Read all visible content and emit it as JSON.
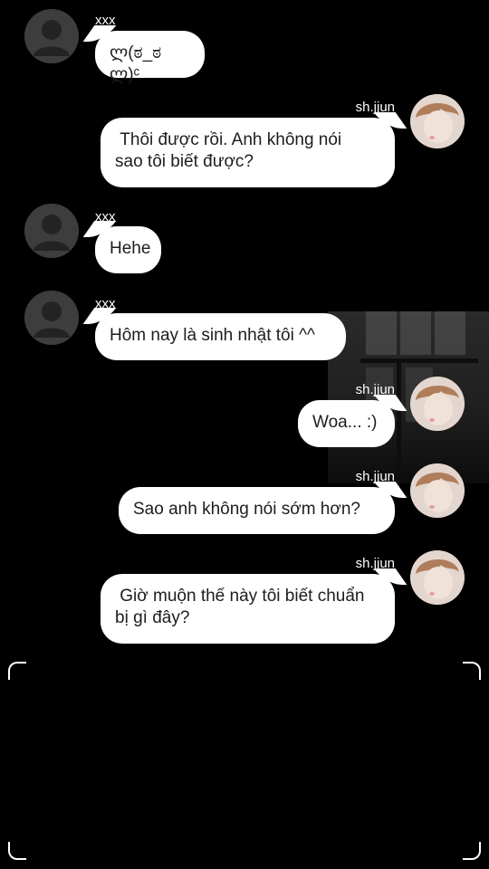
{
  "messages": [
    {
      "side": "left",
      "sender": "xxx",
      "text": "ლ(ಠ_ಠ ლ)ᶜ"
    },
    {
      "side": "right",
      "sender": "sh.jjun",
      "text": " Thôi được rồi. Anh không nói\nsao tôi biết được?"
    },
    {
      "side": "left",
      "sender": "xxx",
      "text": "Hehe"
    },
    {
      "side": "left",
      "sender": "xxx",
      "text": "Hôm nay là sinh nhật tôi ^^"
    },
    {
      "side": "right",
      "sender": "sh.jjun",
      "text": "Woa... :)"
    },
    {
      "side": "right",
      "sender": "sh.jjun",
      "text": "Sao anh không nói sớm hơn?"
    },
    {
      "side": "right",
      "sender": "sh.jjun",
      "text": " Giờ muộn thế này tôi biết chuẩn\nbị gì đây?"
    }
  ],
  "icons": {
    "default_avatar": "default-avatar-icon",
    "user_avatar": "user-avatar-icon"
  },
  "colors": {
    "background": "#000000",
    "bubble": "#ffffff",
    "text": "#1d1d1d",
    "name": "#ffffff"
  }
}
